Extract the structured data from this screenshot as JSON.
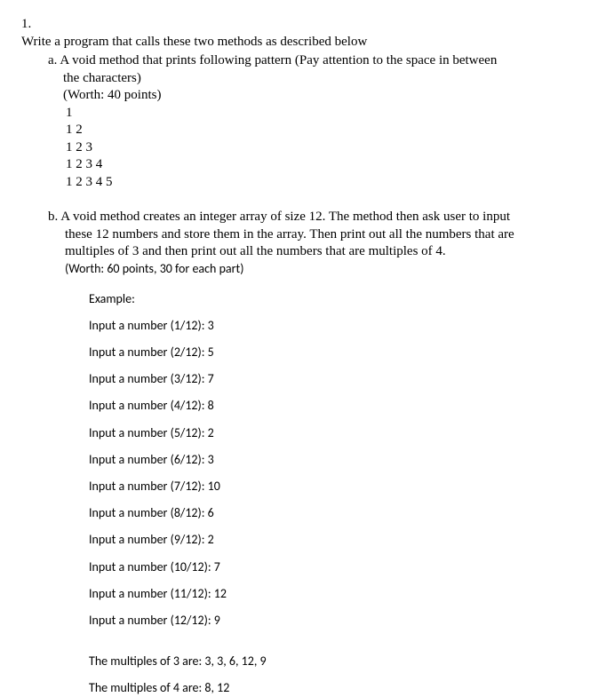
{
  "question": {
    "number": "1.",
    "intro": "Write a program that calls these two methods as described below",
    "part_a": {
      "letter": "a.",
      "text_line1": "A void method that prints following pattern (Pay attention to the space in between",
      "text_line2": "the characters)",
      "worth": "(Worth: 40 points)",
      "pattern": [
        "1",
        "1 2",
        "1 2 3",
        "1 2 3 4",
        "1 2 3 4 5"
      ]
    },
    "part_b": {
      "letter": "b.",
      "text_line1": "A void method creates an integer array of size 12. The method then ask user to input",
      "text_line2": "these 12 numbers and store them in the array. Then print out all the numbers that are",
      "text_line3": "multiples of 3 and then print out all the numbers that are multiples of 4.",
      "worth": "(Worth: 60 points, 30 for each part)",
      "example_label": "Example:",
      "inputs": [
        "Input a number (1/12): 3",
        "Input a number (2/12): 5",
        "Input a number (3/12): 7",
        "Input a number (4/12): 8",
        "Input a number (5/12): 2",
        "Input a number (6/12): 3",
        "Input a number (7/12): 10",
        "Input a number (8/12): 6",
        "Input a number (9/12): 2",
        "Input a number (10/12): 7",
        "Input a number (11/12): 12",
        "Input a number (12/12): 9"
      ],
      "result_mult3": "The multiples of 3 are: 3, 3, 6, 12, 9",
      "result_mult4": "The multiples of 4 are: 8, 12"
    }
  }
}
